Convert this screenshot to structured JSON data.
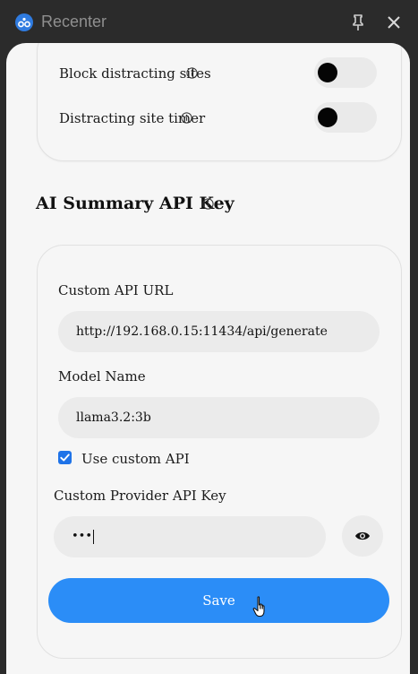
{
  "window": {
    "title": "Recenter",
    "logo_icon": "recenter-logo-icon",
    "pin_icon": "pin-icon",
    "close_icon": "close-icon"
  },
  "settings": {
    "block_sites": {
      "label": "Block distracting sites",
      "enabled": false
    },
    "site_timer": {
      "label": "Distracting site timer",
      "enabled": false
    }
  },
  "ai_section": {
    "title": "AI Summary API Key",
    "custom_url_label": "Custom API URL",
    "custom_url_value": "http://192.168.0.15:11434/api/generate",
    "model_label": "Model Name",
    "model_value": "llama3.2:3b",
    "use_custom_label": "Use custom API",
    "use_custom_checked": true,
    "provider_key_label": "Custom Provider API Key",
    "provider_key_value": "•••",
    "save_label": "Save"
  },
  "colors": {
    "accent": "#2b8df7",
    "checkbox": "#1f73e8",
    "panel_bg": "#f6f6f6",
    "titlebar_bg": "#2b2b2b"
  }
}
